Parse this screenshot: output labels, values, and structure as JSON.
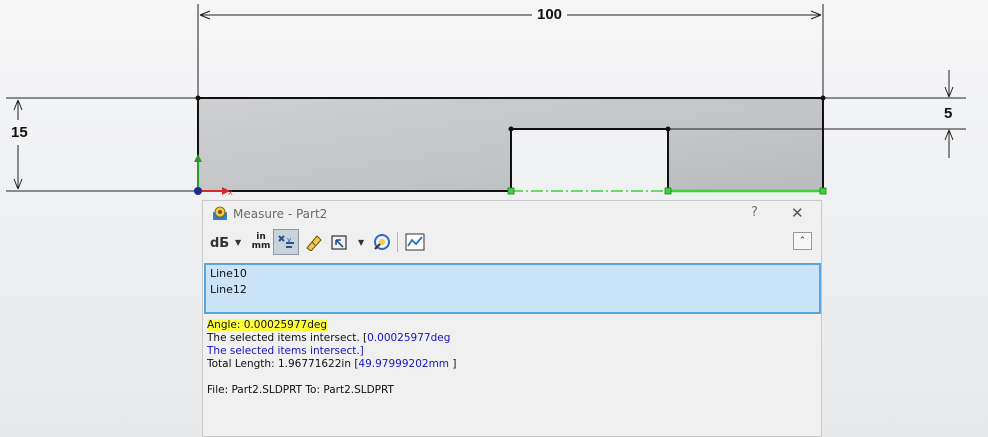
{
  "sketch": {
    "dim_top": "100",
    "dim_left": "15",
    "dim_right": "5"
  },
  "measure_dialog": {
    "title": "Measure - Part2",
    "help_label": "?",
    "close_label": "✕",
    "toolbar": [
      {
        "name": "arc-circle-measure-icon"
      },
      {
        "name": "units-precision-icon",
        "top": "in",
        "bottom": "mm"
      },
      {
        "name": "xyz-measure-icon"
      },
      {
        "name": "point-to-point-icon"
      },
      {
        "name": "projection-icon"
      },
      {
        "name": "measure-history-icon"
      },
      {
        "name": "create-sensor-icon"
      }
    ],
    "collapse_label": "⌃",
    "selections": [
      "Line10",
      "Line12"
    ],
    "results": {
      "angle": "Angle: 0.00025977deg",
      "intersect1_prefix": "The selected items intersect. [",
      "intersect1_value": "0.00025977deg",
      "intersect2": "The selected items intersect.]",
      "length_prefix": "Total Length: 1.96771622in  [",
      "length_value": "49.97999202mm",
      "length_suffix": " ]",
      "file_line": "File: Part2.SLDPRT To: Part2.SLDPRT"
    }
  },
  "colors": {
    "part_fill": "#c4c6c9",
    "sketch_line": "#111111",
    "selected_line": "#3fd13f",
    "selection_bg": "#cce4f7",
    "highlight": "#ffff3a",
    "result_blue": "#1515c8"
  }
}
